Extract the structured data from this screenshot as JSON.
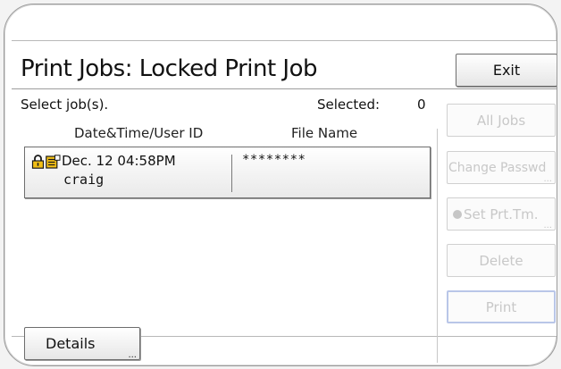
{
  "screen": {
    "title": "Print Jobs: Locked Print Job",
    "prompt": "Select job(s).",
    "selected_label": "Selected:",
    "selected_count": "0",
    "exit_label": "Exit"
  },
  "columns": {
    "date_user": "Date&Time/User ID",
    "file_name": "File Name"
  },
  "jobs": [
    {
      "datetime": "Dec. 12 04:58PM",
      "user": "craig",
      "file": "********",
      "icons": [
        "lock-icon",
        "document-icon"
      ]
    }
  ],
  "side_buttons": {
    "all_jobs": "All Jobs",
    "change_password": "Change Passwd",
    "set_print_time": "Set Prt.Tm.",
    "delete": "Delete",
    "print": "Print"
  },
  "details_label": "Details",
  "ellipsis": "...",
  "colors": {
    "accent_disabled_border": "#b9c6e8",
    "text": "#111111",
    "disabled_text": "#c8c8c8"
  }
}
